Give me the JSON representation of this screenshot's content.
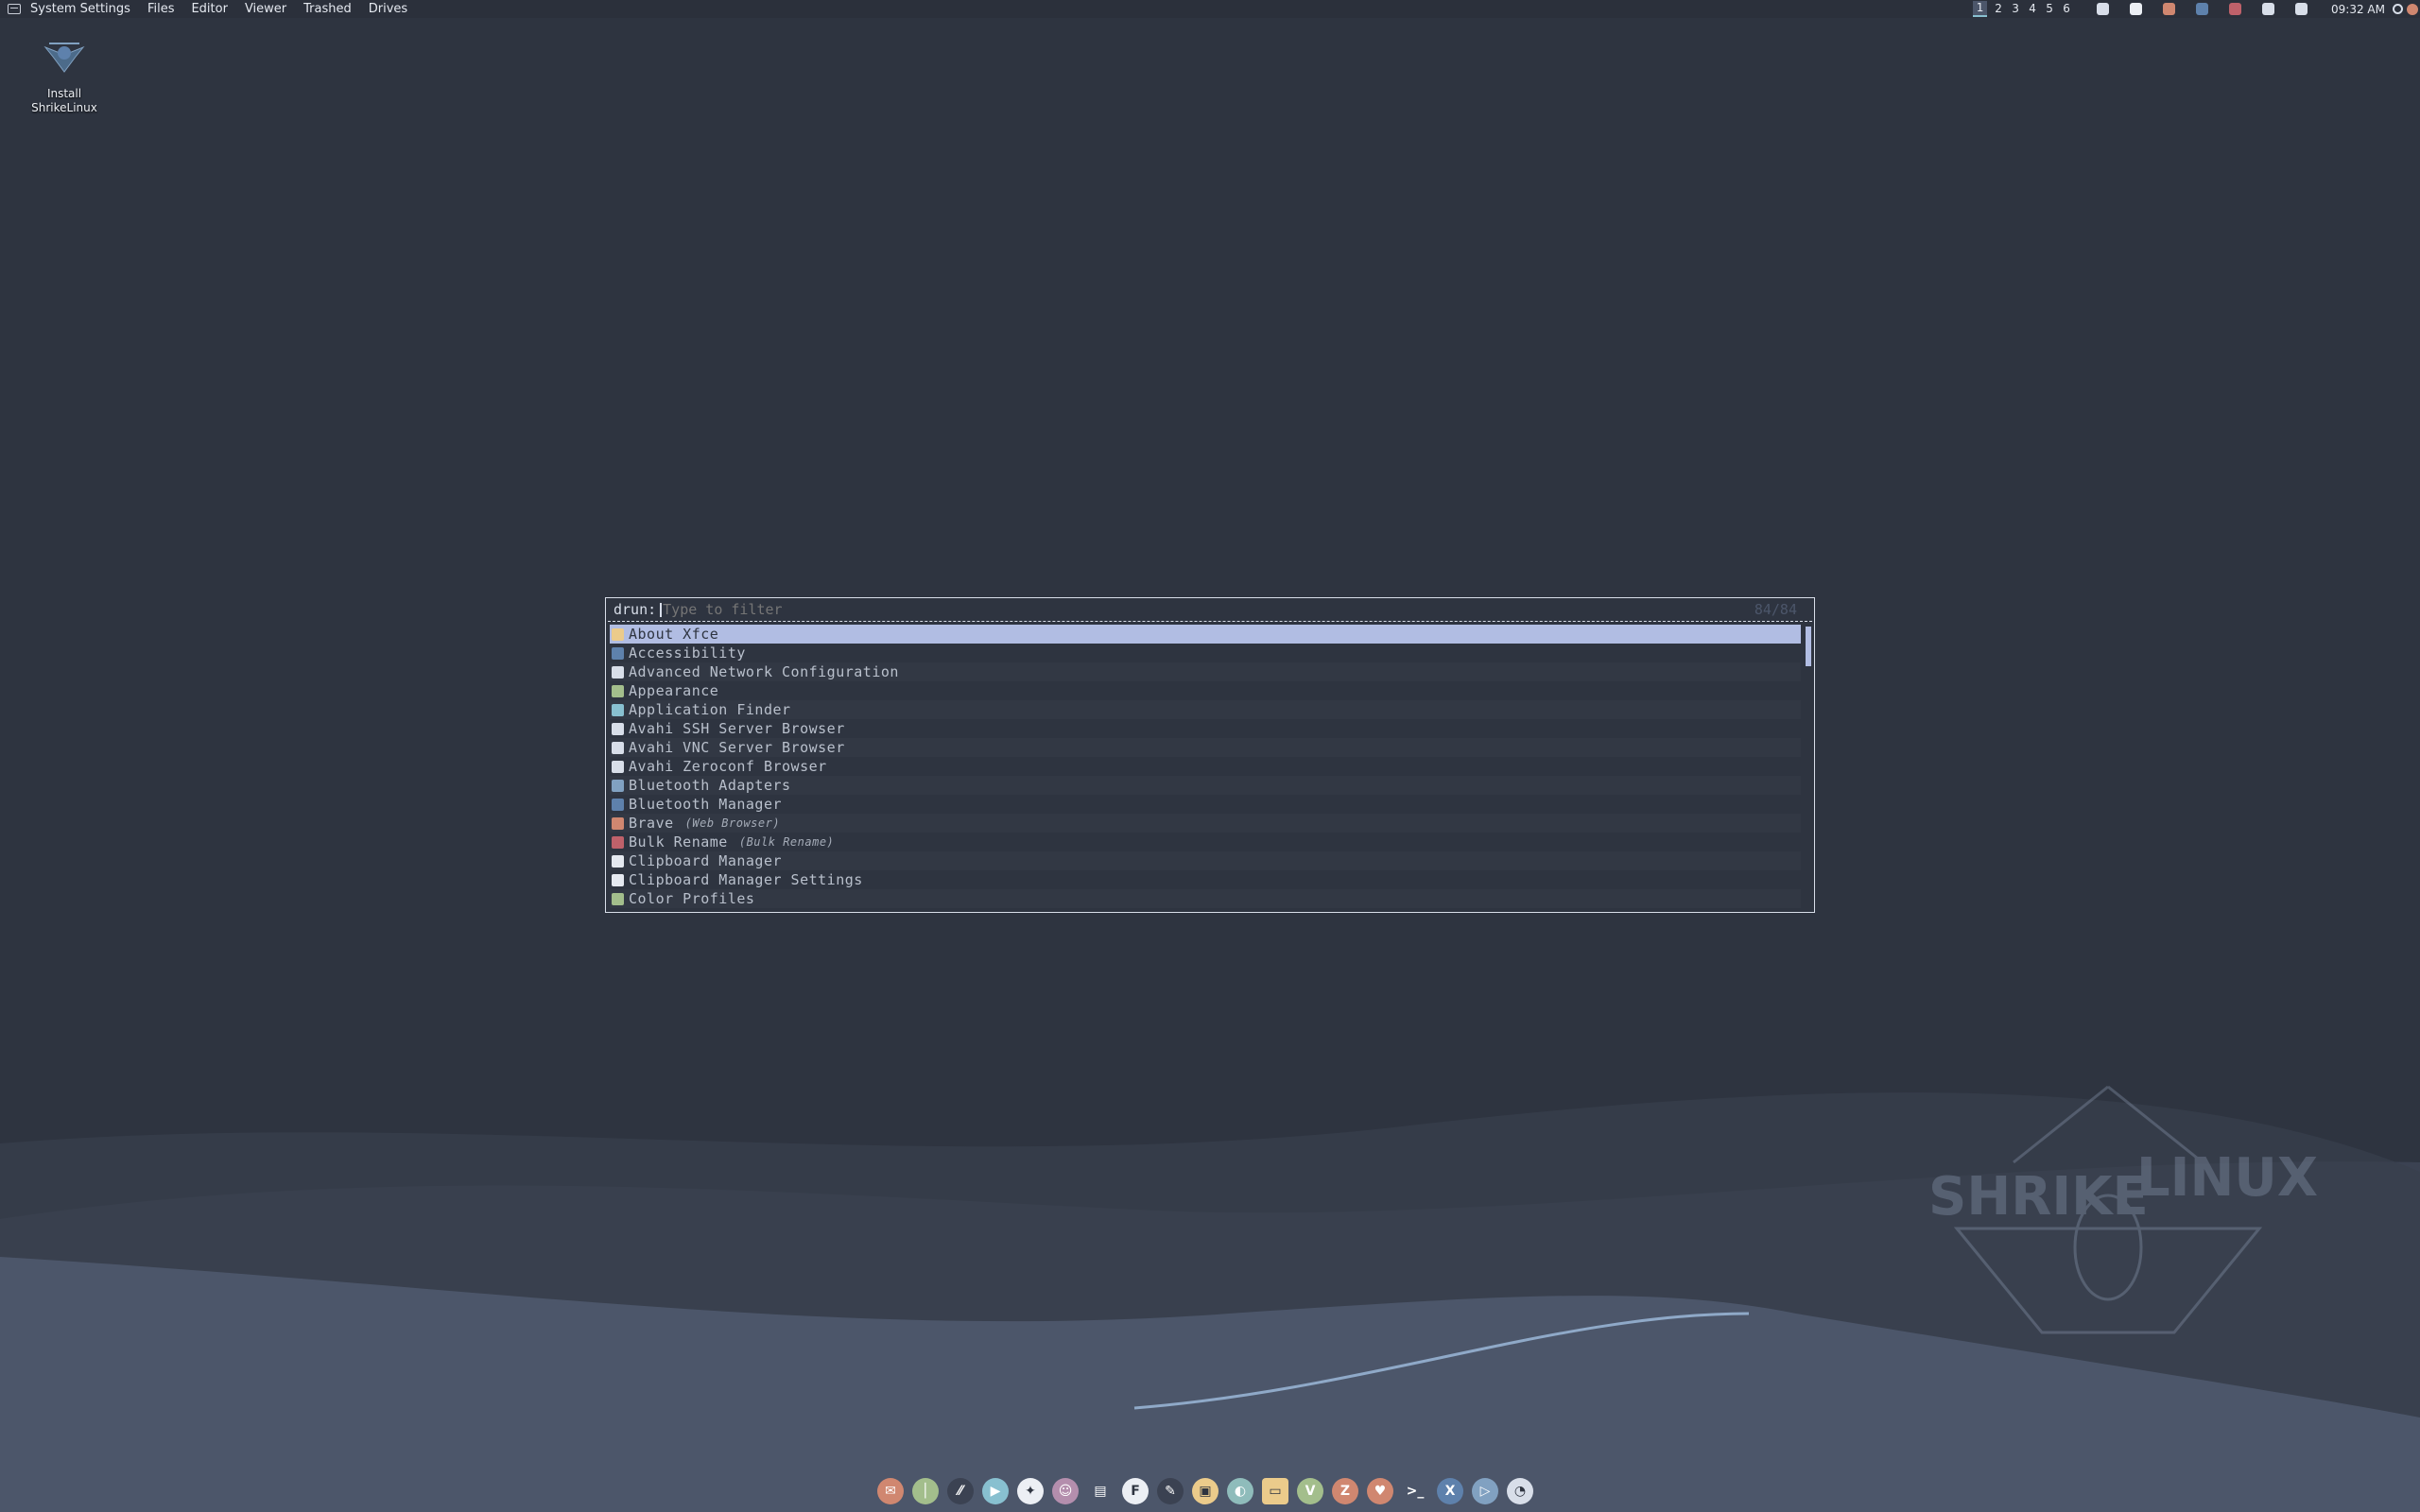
{
  "top_panel": {
    "app_menu_icon": "whisker-menu-icon",
    "menu_items": [
      "System Settings",
      "Files",
      "Editor",
      "Viewer",
      "Trashed",
      "Drives"
    ],
    "workspaces": [
      "1",
      "2",
      "3",
      "4",
      "5",
      "6"
    ],
    "active_workspace": "1",
    "tray_icons": [
      {
        "name": "clipboard-icon",
        "color": "#d8dee9"
      },
      {
        "name": "network-icon",
        "color": "#eceff4"
      },
      {
        "name": "updates-icon",
        "color": "#d08770"
      },
      {
        "name": "bluetooth-icon",
        "color": "#5e81ac"
      },
      {
        "name": "notes-icon",
        "color": "#bf616a"
      },
      {
        "name": "volume-icon",
        "color": "#d8dee9"
      },
      {
        "name": "display-icon",
        "color": "#d8dee9"
      }
    ],
    "clock": "09:32 AM"
  },
  "desktop": {
    "icons": [
      {
        "label_line1": "Install",
        "label_line2": "ShrikeLinux"
      }
    ]
  },
  "launcher": {
    "prompt": "drun:",
    "placeholder": "Type to filter",
    "counter": "84/84",
    "items": [
      {
        "label": "About Xfce",
        "sub": "",
        "icon_color": "#ebcb8b",
        "selected": true
      },
      {
        "label": "Accessibility",
        "sub": "",
        "icon_color": "#5e81ac"
      },
      {
        "label": "Advanced Network Configuration",
        "sub": "",
        "icon_color": "#d8dee9"
      },
      {
        "label": "Appearance",
        "sub": "",
        "icon_color": "#a3be8c"
      },
      {
        "label": "Application Finder",
        "sub": "",
        "icon_color": "#88c0d0"
      },
      {
        "label": "Avahi SSH Server Browser",
        "sub": "",
        "icon_color": "#d8dee9"
      },
      {
        "label": "Avahi VNC Server Browser",
        "sub": "",
        "icon_color": "#d8dee9"
      },
      {
        "label": "Avahi Zeroconf Browser",
        "sub": "",
        "icon_color": "#d8dee9"
      },
      {
        "label": "Bluetooth Adapters",
        "sub": "",
        "icon_color": "#81a1c1"
      },
      {
        "label": "Bluetooth Manager",
        "sub": "",
        "icon_color": "#5e81ac"
      },
      {
        "label": "Brave",
        "sub": "(Web Browser)",
        "icon_color": "#d08770"
      },
      {
        "label": "Bulk Rename",
        "sub": "(Bulk Rename)",
        "icon_color": "#bf616a"
      },
      {
        "label": "Clipboard Manager",
        "sub": "",
        "icon_color": "#e5e9f0"
      },
      {
        "label": "Clipboard Manager Settings",
        "sub": "",
        "icon_color": "#e5e9f0"
      },
      {
        "label": "Color Profiles",
        "sub": "",
        "icon_color": "#a3be8c"
      }
    ]
  },
  "dock": {
    "items": [
      {
        "name": "mail-icon",
        "color": "#d08770",
        "glyph": "✉"
      },
      {
        "name": "maps-icon",
        "color": "#a3be8c",
        "glyph": "│"
      },
      {
        "name": "tool-icon",
        "color": "#3b4252",
        "glyph": "⁄⁄"
      },
      {
        "name": "video-icon",
        "color": "#88c0d0",
        "glyph": "▶"
      },
      {
        "name": "compass-icon",
        "color": "#eceff4",
        "glyph": "✦"
      },
      {
        "name": "user-icon",
        "color": "#b48ead",
        "glyph": "☺"
      },
      {
        "name": "print-icon",
        "color": "#4c566a",
        "glyph": "▤"
      },
      {
        "name": "foxit-icon",
        "color": "#eceff4",
        "glyph": "F"
      },
      {
        "name": "pen-icon",
        "color": "#3b4252",
        "glyph": "✎"
      },
      {
        "name": "archive-icon",
        "color": "#ebcb8b",
        "glyph": "▣"
      },
      {
        "name": "ghost-icon",
        "color": "#8fbcbb",
        "glyph": "◐"
      },
      {
        "name": "folder-icon",
        "color": "#ebcb8b",
        "glyph": "▭"
      },
      {
        "name": "vim-icon",
        "color": "#a3be8c",
        "glyph": "V"
      },
      {
        "name": "filezilla-icon",
        "color": "#d08770",
        "glyph": "Z"
      },
      {
        "name": "brave-icon",
        "color": "#d08770",
        "glyph": "♥"
      },
      {
        "name": "terminal-icon",
        "color": "#4c566a",
        "glyph": ">_"
      },
      {
        "name": "xorg-icon",
        "color": "#5e81ac",
        "glyph": "X"
      },
      {
        "name": "media-player-icon",
        "color": "#81a1c1",
        "glyph": "▷"
      },
      {
        "name": "disk-icon",
        "color": "#d8dee9",
        "glyph": "◔"
      }
    ]
  }
}
